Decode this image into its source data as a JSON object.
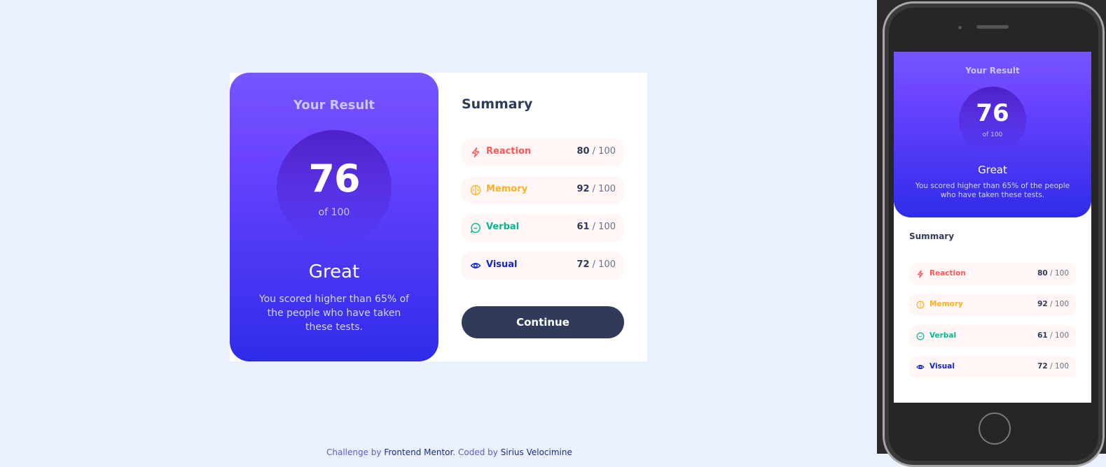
{
  "colors": {
    "page_bg": "#ebf1ff",
    "reaction": "#ff5757",
    "memory": "#ffb01f",
    "verbal": "#00bb8f",
    "visual": "#1125d6",
    "button": "#303b59"
  },
  "result": {
    "title": "Your Result",
    "score": "76",
    "out_of": "of 100",
    "rating": "Great",
    "description": "You scored higher than 65% of the people who have taken these tests."
  },
  "summary": {
    "title": "Summary",
    "max_suffix": "/ 100",
    "items": [
      {
        "label": "Reaction",
        "score": "80",
        "icon": "lightning-icon"
      },
      {
        "label": "Memory",
        "score": "92",
        "icon": "brain-icon"
      },
      {
        "label": "Verbal",
        "score": "61",
        "icon": "chat-icon"
      },
      {
        "label": "Visual",
        "score": "72",
        "icon": "eye-icon"
      }
    ]
  },
  "continue_label": "Continue",
  "footer": {
    "challenge_prefix": "Challenge by",
    "challenge_link": "Frontend Mentor",
    "coded_prefix": ". Coded by",
    "author_link": "Sirius Velocimine"
  }
}
